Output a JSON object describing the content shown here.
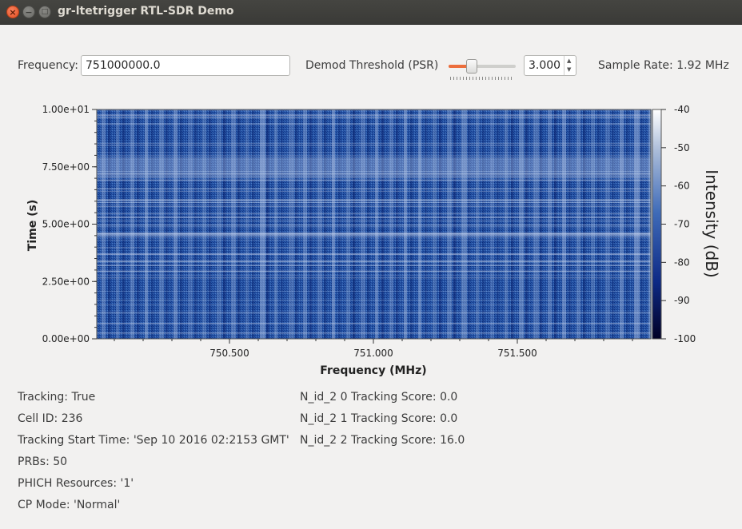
{
  "window": {
    "title": "gr-ltetrigger RTL-SDR Demo",
    "close_glyph": "×",
    "minimize_glyph": "−",
    "maximize_glyph": "□"
  },
  "controls": {
    "frequency_label": "Frequency:",
    "frequency_value": "751000000.0",
    "threshold_label": "Demod Threshold (PSR)",
    "threshold_slider_fraction": 0.35,
    "threshold_value": "3.000",
    "sample_rate_label": "Sample Rate: 1.92 MHz"
  },
  "waterfall": {
    "ylabel": "Time (s)",
    "xlabel": "Frequency (MHz)",
    "colorbar_label": "Intensity (dB)",
    "y_ticks": [
      "1.00e+01",
      "7.50e+00",
      "5.00e+00",
      "2.50e+00",
      "0.00e+00"
    ],
    "x_ticks": [
      "750.500",
      "751.000",
      "751.500"
    ],
    "colorbar_ticks": [
      "-40",
      "-50",
      "-60",
      "-70",
      "-80",
      "-90",
      "-100"
    ],
    "colors": {
      "low": "#000035",
      "mid": "#1f4f9f",
      "high": "#ffffff"
    }
  },
  "status": {
    "left": [
      "Tracking: True",
      "Cell ID: 236",
      "Tracking Start Time: 'Sep 10 2016 02:2153 GMT'",
      "PRBs: 50",
      "PHICH Resources: '1'",
      "CP Mode: 'Normal'"
    ],
    "right": [
      "N_id_2 0 Tracking Score: 0.0",
      "N_id_2 1 Tracking Score: 0.0",
      "N_id_2 2 Tracking Score: 16.0"
    ]
  }
}
